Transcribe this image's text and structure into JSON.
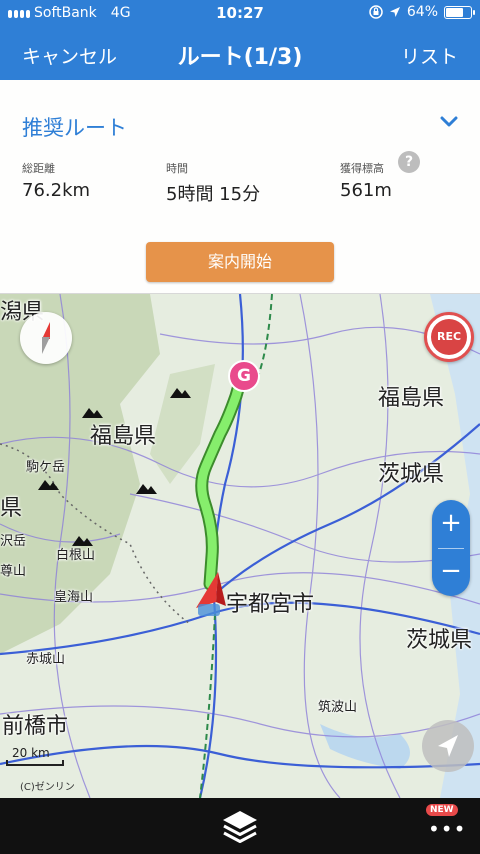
{
  "status": {
    "carrier": "SoftBank",
    "network": "4G",
    "time": "10:27",
    "battery": "64%",
    "battery_level": 0.64
  },
  "nav": {
    "cancel": "キャンセル",
    "title": "ルート(1/3)",
    "list": "リスト"
  },
  "route": {
    "name": "推奨ルート",
    "distance_label": "総距離",
    "distance": "76.2km",
    "time_label": "時間",
    "time": "5時間 15分",
    "elevation_label": "獲得標高",
    "elevation": "561m",
    "help": "?",
    "start_button": "案内開始"
  },
  "map": {
    "labels": {
      "niigata": "潟県",
      "fukushima_w": "福島県",
      "fukushima_e": "福島県",
      "ibaraki_1": "茨城県",
      "ibaraki_2": "茨城県",
      "prefecture_w": "県",
      "utsunomiya": "宇都宮市",
      "maebashi": "前橋市",
      "komagatake": "駒ケ岳",
      "shiranesan": "白根山",
      "koushasan": "皇海山",
      "akagisan": "赤城山",
      "tsukubasan": "筑波山",
      "sawadake": "沢岳",
      "takasan": "尊山"
    },
    "goal_marker": "G",
    "rec": "REC",
    "zoom_in": "+",
    "zoom_out": "−",
    "scale": "20 km",
    "copyright": "(C)ゼンリン"
  },
  "bottom": {
    "new_badge": "NEW",
    "more": "•••"
  },
  "colors": {
    "primary": "#2f7fd6",
    "accent": "#e6934a",
    "route": "#7fe06a",
    "goal": "#e94a8c",
    "rec": "#d94444"
  }
}
